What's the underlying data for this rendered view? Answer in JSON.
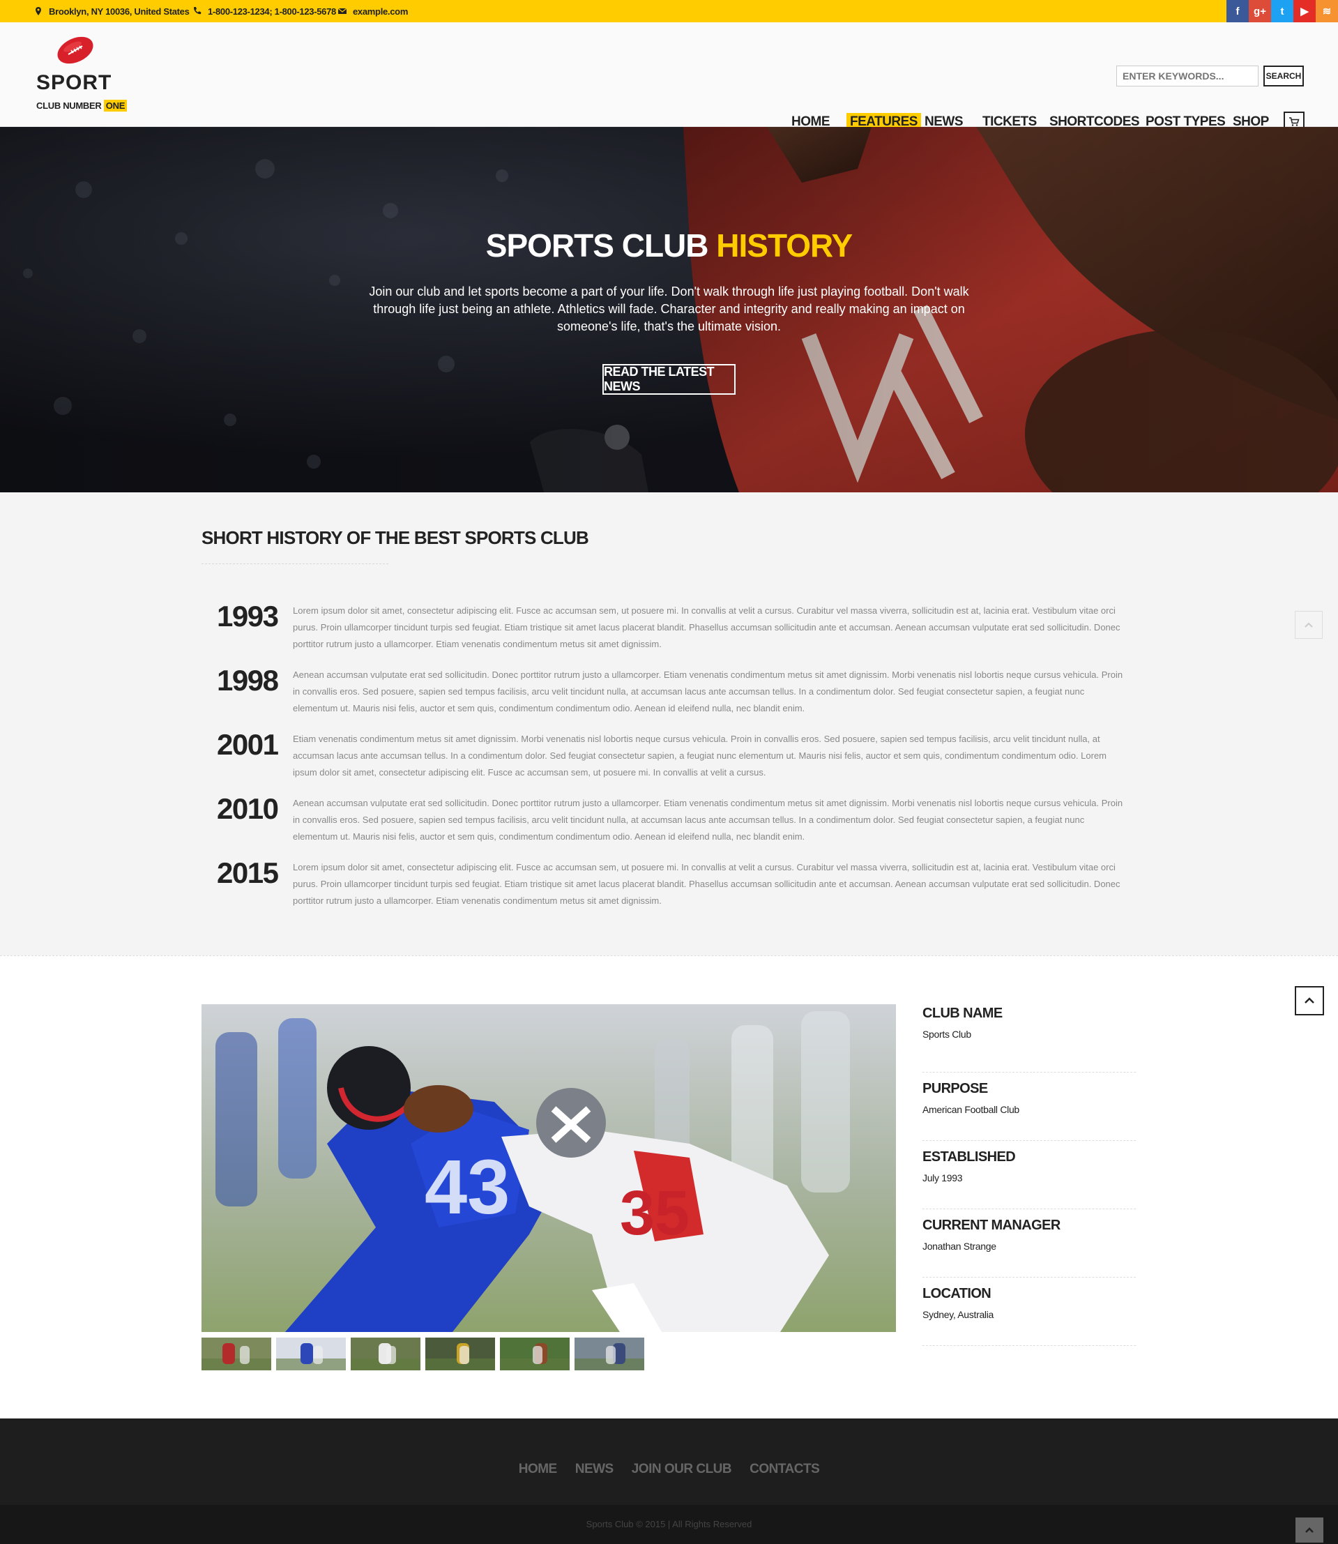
{
  "topbar": {
    "address": "Brooklyn, NY 10036, United States",
    "phone": "1-800-123-1234; 1-800-123-5678",
    "email": "example.com",
    "social": [
      {
        "name": "facebook",
        "glyph": "f",
        "color": "#3b5998"
      },
      {
        "name": "google-plus",
        "glyph": "g+",
        "color": "#dd4b39"
      },
      {
        "name": "twitter",
        "glyph": "t",
        "color": "#1da1f2"
      },
      {
        "name": "youtube",
        "glyph": "▶",
        "color": "#e52d27"
      },
      {
        "name": "rss",
        "glyph": "≋",
        "color": "#f69330"
      }
    ]
  },
  "logo": {
    "word": "SPORT",
    "sub_prefix": "CLUB NUMBER",
    "sub_highlight": "ONE"
  },
  "search": {
    "placeholder": "ENTER KEYWORDS...",
    "button": "SEARCH"
  },
  "nav": [
    "HOME",
    "FEATURES",
    "NEWS",
    "TICKETS",
    "SHORTCODES",
    "POST TYPES",
    "SHOP"
  ],
  "nav_active": "FEATURES",
  "hero": {
    "title_white": "SPORTS CLUB",
    "title_yellow": "HISTORY",
    "text": "Join our club and let sports become a part of your life. Don't walk through life just playing football. Don't walk through life just being an athlete. Athletics will fade. Character and integrity and really making an impact on someone's life, that's the ultimate vision.",
    "button": "READ THE LATEST NEWS"
  },
  "history": {
    "title": "SHORT HISTORY OF THE BEST SPORTS CLUB",
    "entries": [
      {
        "year": "1993",
        "text": "Lorem ipsum dolor sit amet, consectetur adipiscing elit. Fusce ac accumsan sem, ut posuere mi. In convallis at velit a cursus. Curabitur vel massa viverra, sollicitudin est at, lacinia erat. Vestibulum vitae orci purus. Proin ullamcorper tincidunt turpis sed feugiat. Etiam tristique sit amet lacus placerat blandit. Phasellus accumsan sollicitudin ante et accumsan. Aenean accumsan vulputate erat sed sollicitudin. Donec porttitor rutrum justo a ullamcorper. Etiam venenatis condimentum metus sit amet dignissim."
      },
      {
        "year": "1998",
        "text": "Aenean accumsan vulputate erat sed sollicitudin. Donec porttitor rutrum justo a ullamcorper. Etiam venenatis condimentum metus sit amet dignissim. Morbi venenatis nisl lobortis neque cursus vehicula. Proin in convallis eros. Sed posuere, sapien sed tempus facilisis, arcu velit tincidunt nulla, at accumsan lacus ante accumsan tellus. In a condimentum dolor. Sed feugiat consectetur sapien, a feugiat nunc elementum ut. Mauris nisi felis, auctor et sem quis, condimentum condimentum odio. Aenean id eleifend nulla, nec blandit enim."
      },
      {
        "year": "2001",
        "text": "Etiam venenatis condimentum metus sit amet dignissim. Morbi venenatis nisl lobortis neque cursus vehicula. Proin in convallis eros. Sed posuere, sapien sed tempus facilisis, arcu velit tincidunt nulla, at accumsan lacus ante accumsan tellus. In a condimentum dolor. Sed feugiat consectetur sapien, a feugiat nunc elementum ut. Mauris nisi felis, auctor et sem quis, condimentum condimentum odio. Lorem ipsum dolor sit amet, consectetur adipiscing elit. Fusce ac accumsan sem, ut posuere mi. In convallis at velit a cursus."
      },
      {
        "year": "2010",
        "text": "Aenean accumsan vulputate erat sed sollicitudin. Donec porttitor rutrum justo a ullamcorper. Etiam venenatis condimentum metus sit amet dignissim. Morbi venenatis nisl lobortis neque cursus vehicula. Proin in convallis eros. Sed posuere, sapien sed tempus facilisis, arcu velit tincidunt nulla, at accumsan lacus ante accumsan tellus. In a condimentum dolor. Sed feugiat consectetur sapien, a feugiat nunc elementum ut. Mauris nisi felis, auctor et sem quis, condimentum condimentum odio. Aenean id eleifend nulla, nec blandit enim."
      },
      {
        "year": "2015",
        "text": "Lorem ipsum dolor sit amet, consectetur adipiscing elit. Fusce ac accumsan sem, ut posuere mi. In convallis at velit a cursus. Curabitur vel massa viverra, sollicitudin est at, lacinia erat. Vestibulum vitae orci purus. Proin ullamcorper tincidunt turpis sed feugiat. Etiam tristique sit amet lacus placerat blandit. Phasellus accumsan sollicitudin ante et accumsan. Aenean accumsan vulputate erat sed sollicitudin. Donec porttitor rutrum justo a ullamcorper. Etiam venenatis condimentum metus sit amet dignissim."
      }
    ]
  },
  "club_facts": [
    {
      "label": "CLUB NAME",
      "value": "Sports Club"
    },
    {
      "label": "PURPOSE",
      "value": "American Football Club"
    },
    {
      "label": "ESTABLISHED",
      "value": "July 1993"
    },
    {
      "label": "CURRENT MANAGER",
      "value": "Jonathan Strange"
    },
    {
      "label": "LOCATION",
      "value": "Sydney, Australia"
    }
  ],
  "footer": {
    "nav": [
      "HOME",
      "NEWS",
      "JOIN OUR CLUB",
      "CONTACTS"
    ],
    "copyright": "Sports Club © 2015 | All Rights Reserved"
  },
  "colors": {
    "accent": "#ffcc00",
    "dark": "#222222",
    "footer": "#1e1e1e"
  }
}
